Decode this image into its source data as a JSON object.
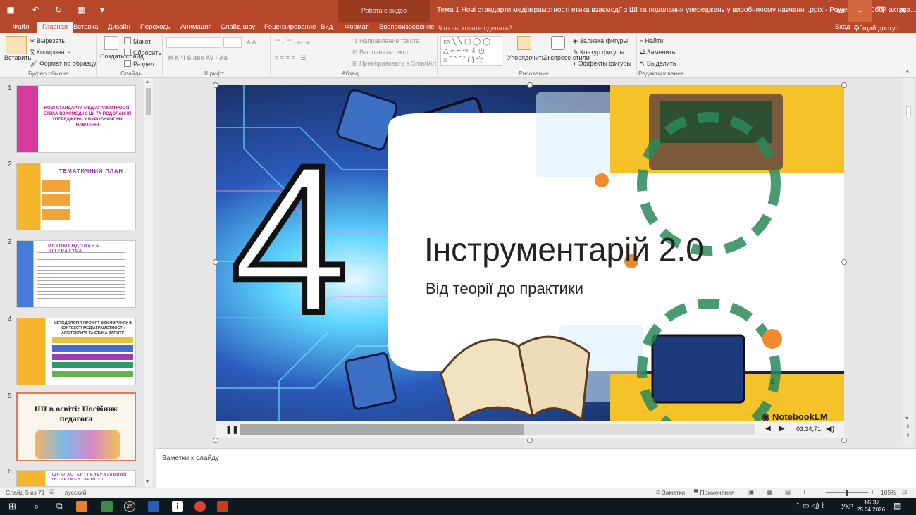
{
  "app": {
    "title": "Тема 1 Нові стандарти медіаграмотності етика взаємодії з ШІ та подолання упереджень у виробничому навчанні .pptx - PowerPoint (Сбой актива...",
    "context_tab": "Работа с видео",
    "signin": "Вход",
    "share": "Общий доступ"
  },
  "tabs": [
    "Файл",
    "Главная",
    "Вставка",
    "Дизайн",
    "Переходы",
    "Анимация",
    "Слайд-шоу",
    "Рецензирование",
    "Вид",
    "Формат",
    "Воспроизведение"
  ],
  "tell_me": "Что вы хотите сделать?",
  "ribbon": {
    "clipboard": {
      "paste": "Вставить",
      "cut": "Вырезать",
      "copy": "Копировать",
      "format_painter": "Формат по образцу",
      "group": "Буфер обмена"
    },
    "slides": {
      "new_slide": "Создать слайд",
      "layout": "Макет",
      "reset": "Сбросить",
      "section": "Раздел",
      "group": "Слайды"
    },
    "font": {
      "group": "Шрифт",
      "buttons": "Ж  К  Ч  S  abc  AV ·  Aa ·",
      "size_buttons": "A  A"
    },
    "paragraph": {
      "text_dir": "Направление текста",
      "align_text": "Выровнять текст",
      "smartart": "Преобразовать в SmartArt",
      "group": "Абзац"
    },
    "drawing": {
      "arrange": "Упорядочить",
      "quick_styles": "Экспресс-стили",
      "fill": "Заливка фигуры",
      "outline": "Контур фигуры",
      "effects": "Эффекты фигуры",
      "group": "Рисование"
    },
    "editing": {
      "find": "Найти",
      "replace": "Заменить",
      "select": "Выделить",
      "group": "Редактирование"
    }
  },
  "thumbnails": [
    {
      "num": "1",
      "title": "НОВІ СТАНДАРТИ МЕДІАГРАМОТНОСТІ: ЕТИКА ВЗАЄМОДІЇ З ШІ ТА ПОДОЛАННЯ УПЕРЕДЖЕНЬ У ВИРОБНИЧОМУ НАВЧАННІ"
    },
    {
      "num": "2",
      "title": "ТЕМАТИЧНИЙ ПЛАН"
    },
    {
      "num": "3",
      "title": "РЕКОМЕНДОВАНА ЛІТЕРАТУРА"
    },
    {
      "num": "4",
      "title": "МЕТОДОЛОГІЯ ПРОМПТ-ІНЖИНІРИНГУ В КОНТЕКСТІ МЕДІАГРАМОТНОСТІ: АРХІТЕКТУРА ТА ЕТИКА ЗАПИТУ"
    },
    {
      "num": "5",
      "title": "ШІ в освіті: Посібник педагога"
    },
    {
      "num": "6",
      "title": "ШІ-КЛАСТЕР: ГЕНЕРАТИВНИЙ ІНСТРУМЕНТАРІЙ 2.0"
    }
  ],
  "slide": {
    "big_number": "4",
    "title": "Інструментарій 2.0",
    "subtitle": "Від теорії до практики",
    "brand": "NotebookLM",
    "small_zero": "0"
  },
  "player": {
    "time": "03:34,71",
    "progress": 0.55
  },
  "notes_placeholder": "Заметки к слайду",
  "status": {
    "slide_count": "Слайд 5 из 71",
    "language": "русский",
    "notes": "Заметки",
    "comments": "Примечания",
    "zoom": "105%"
  },
  "taskbar": {
    "lang": "УКР",
    "time": "16:37",
    "date": "25.04.2026",
    "badge": "24"
  }
}
